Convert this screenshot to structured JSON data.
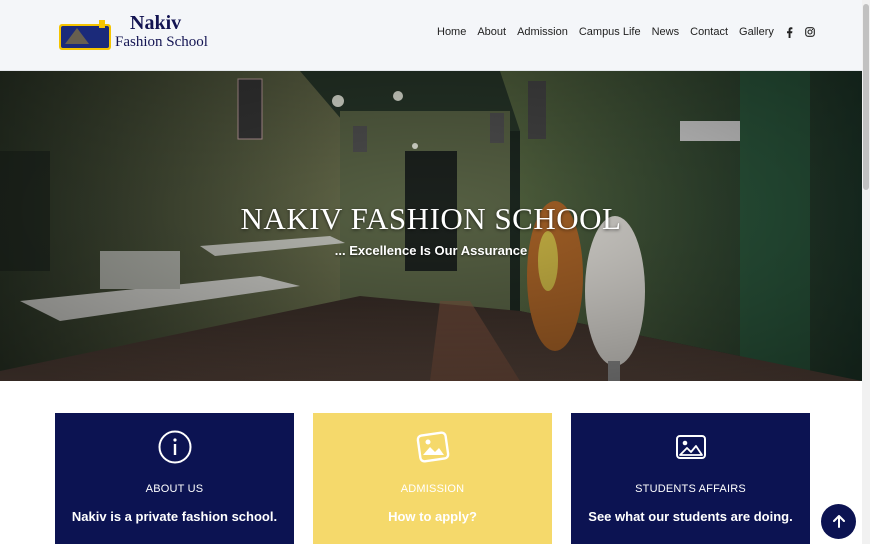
{
  "header": {
    "logo_badge_text": "nakiv",
    "logo_title": "Nakiv",
    "logo_subtitle": "Fashion School"
  },
  "nav": {
    "items": [
      {
        "label": "Home"
      },
      {
        "label": "About"
      },
      {
        "label": "Admission"
      },
      {
        "label": "Campus Life"
      },
      {
        "label": "News"
      },
      {
        "label": "Contact"
      },
      {
        "label": "Gallery"
      }
    ],
    "social_icons": [
      "facebook-icon",
      "instagram-icon"
    ]
  },
  "hero": {
    "title": "NAKIV FASHION SCHOOL",
    "tagline": "... Excellence Is Our Assurance"
  },
  "cards": [
    {
      "icon": "info-circle-icon",
      "title": "ABOUT US",
      "text": "Nakiv is a private fashion school."
    },
    {
      "icon": "image-icon",
      "title": "ADMISSION",
      "text": "How to apply?"
    },
    {
      "icon": "image-icon",
      "title": "STUDENTS AFFAIRS",
      "text": "See what our students are doing."
    }
  ],
  "colors": {
    "navy": "#0c1352",
    "yellow": "#f5d96b",
    "header_bg": "#f4f6f9",
    "brand_text": "#131452"
  },
  "back_to_top_icon": "arrow-up-icon"
}
